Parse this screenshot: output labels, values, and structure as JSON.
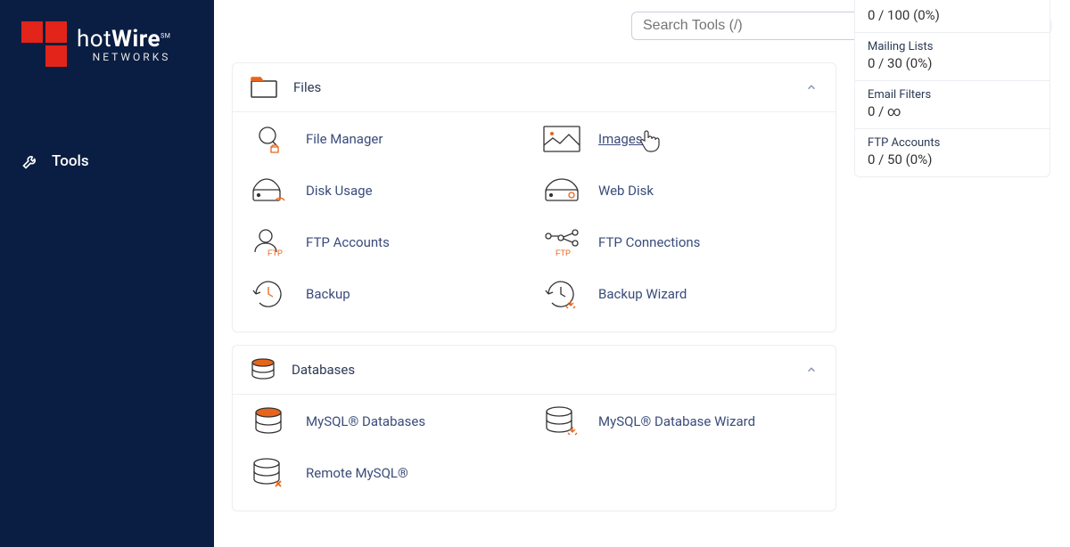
{
  "brand": {
    "name_light": "hot",
    "name_bold": "Wire",
    "sm": "SM",
    "sub": "NETWORKS"
  },
  "nav": {
    "tools": "Tools"
  },
  "search": {
    "placeholder": "Search Tools (/)"
  },
  "stats": [
    {
      "label": "",
      "value": "0 / 100   (0%)"
    },
    {
      "label": "Mailing Lists",
      "value": "0 / 30   (0%)"
    },
    {
      "label": "Email Filters",
      "value": "0 / ∞"
    },
    {
      "label": "FTP Accounts",
      "value": "0 / 50   (0%)"
    }
  ],
  "panels": {
    "files": {
      "title": "Files",
      "items": [
        "File Manager",
        "Images",
        "Disk Usage",
        "Web Disk",
        "FTP Accounts",
        "FTP Connections",
        "Backup",
        "Backup Wizard"
      ]
    },
    "databases": {
      "title": "Databases",
      "items": [
        "MySQL® Databases",
        "MySQL® Database Wizard",
        "Remote MySQL®"
      ]
    }
  }
}
